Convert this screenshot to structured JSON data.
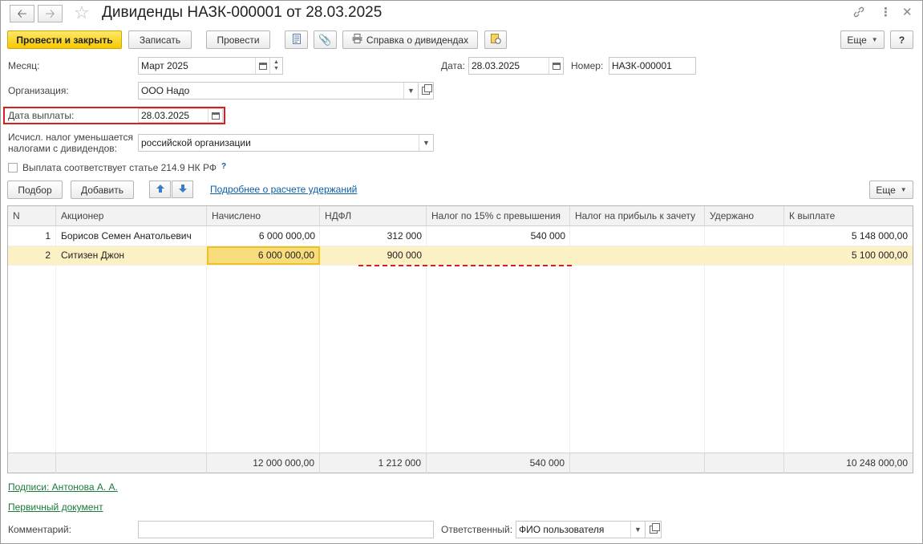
{
  "window": {
    "title": "Дивиденды НАЗК-000001 от 28.03.2025"
  },
  "toolbar": {
    "post_close": "Провести и закрыть",
    "save": "Записать",
    "post": "Провести",
    "dividend_report": "Справка о дивидендах",
    "more": "Еще",
    "help": "?"
  },
  "form": {
    "month_label": "Месяц:",
    "month_value": "Март 2025",
    "date_label": "Дата:",
    "date_value": "28.03.2025",
    "number_label": "Номер:",
    "number_value": "НАЗК-000001",
    "org_label": "Организация:",
    "org_value": "ООО Надо",
    "pay_date_label": "Дата выплаты:",
    "pay_date_value": "28.03.2025",
    "tax_reduce_label_1": "Исчисл. налог уменьшается",
    "tax_reduce_label_2": "налогами с дивидендов:",
    "tax_reduce_value": "российской организации",
    "art_checkbox_label": "Выплата соответствует статье 214.9 НК РФ",
    "art_checkbox_hint": "?",
    "art_checkbox_checked": false
  },
  "table_toolbar": {
    "pick": "Подбор",
    "add": "Добавить",
    "details_link": "Подробнее о расчете удержаний",
    "more": "Еще"
  },
  "table": {
    "headers": {
      "n": "N",
      "shareholder": "Акционер",
      "accrued": "Начислено",
      "ndfl": "НДФЛ",
      "tax15": "Налог по 15% с превышения",
      "profit_tax": "Налог на прибыль к зачету",
      "withheld": "Удержано",
      "to_pay": "К выплате"
    },
    "rows": [
      {
        "n": "1",
        "shareholder": "Борисов Семен Анатольевич",
        "accrued": "6 000 000,00",
        "ndfl": "312 000",
        "tax15": "540 000",
        "profit_tax": "",
        "withheld": "",
        "to_pay": "5 148 000,00"
      },
      {
        "n": "2",
        "shareholder": "Ситизен Джон",
        "accrued": "6 000 000,00",
        "ndfl": "900 000",
        "tax15": "",
        "profit_tax": "",
        "withheld": "",
        "to_pay": "5 100 000,00"
      }
    ],
    "totals": {
      "accrued": "12 000 000,00",
      "ndfl": "1 212 000",
      "tax15": "540 000",
      "to_pay": "10 248 000,00"
    }
  },
  "footer": {
    "signatures_link": "Подписи: Антонова А. А.",
    "primary_doc_link": "Первичный документ",
    "comment_label": "Комментарий:",
    "comment_value": "",
    "responsible_label": "Ответственный:",
    "responsible_value": "ФИО пользователя"
  },
  "colors": {
    "primary_button": "#f5c800",
    "selected_row": "#fcf1c4",
    "focused_cell": "#f8dd7c",
    "highlight_border": "#d81e1e",
    "link_blue": "#0b5ea8",
    "link_green": "#1b7a3a"
  },
  "icons": {
    "back": "arrow-left",
    "forward": "arrow-right",
    "favorite": "star",
    "link": "chain-link",
    "menu": "vertical-ellipsis",
    "close": "close-x",
    "list": "list-document",
    "attach": "paperclip",
    "print": "printer",
    "report": "report-document",
    "up": "arrow-up",
    "down": "arrow-down"
  }
}
